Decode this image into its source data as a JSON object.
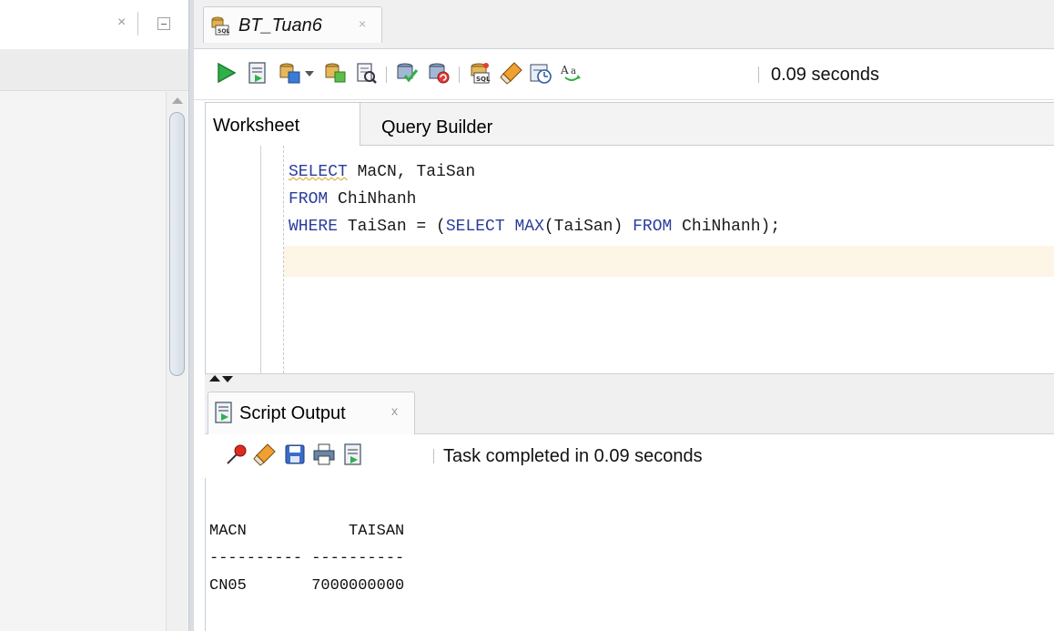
{
  "left_pane": {
    "close_glyph": "×",
    "icons": {
      "minimize": "minimize-icon",
      "scroll_up": "scroll-up-arrow-icon"
    }
  },
  "editor_tab": {
    "label": "BT_Tuan6",
    "close_glyph": "×",
    "icon": "sql-file-icon"
  },
  "toolbar": {
    "status": "0.09 seconds",
    "icons": [
      "run-statement-icon",
      "run-script-icon",
      "autotrace-icon",
      "dropdown-arrow-icon",
      "explain-plan-icon",
      "sql-tuning-icon",
      "commit-icon",
      "rollback-icon",
      "unshared-worksheet-icon",
      "clear-icon",
      "sql-history-icon",
      "format-text-icon"
    ]
  },
  "subtabs": {
    "worksheet": "Worksheet",
    "query_builder": "Query Builder"
  },
  "code": {
    "line1_kw": "SELECT",
    "line1_rest": " MaCN, TaiSan",
    "line2_kw": "FROM",
    "line2_rest": " ChiNhanh",
    "line3_kw1": "WHERE",
    "line3_mid1": " TaiSan = (",
    "line3_kw2": "SELECT",
    "line3_sp": " ",
    "line3_kw3": "MAX",
    "line3_mid2": "(TaiSan) ",
    "line3_kw4": "FROM",
    "line3_end": " ChiNhanh);"
  },
  "output_tab": {
    "label": "Script Output",
    "close_glyph": "x",
    "icon": "script-output-icon"
  },
  "output_toolbar": {
    "status": "Task completed in 0.09 seconds",
    "icons": [
      "pin-icon",
      "clear-icon",
      "save-icon",
      "print-icon",
      "open-file-icon"
    ]
  },
  "result": {
    "header": "MACN           TAISAN",
    "separator": "---------- ----------",
    "row1": "CN05       7000000000"
  },
  "colors": {
    "keyword": "#2a3d9c",
    "current_line": "#fdf6e6",
    "run_green": "#2fb04a"
  }
}
